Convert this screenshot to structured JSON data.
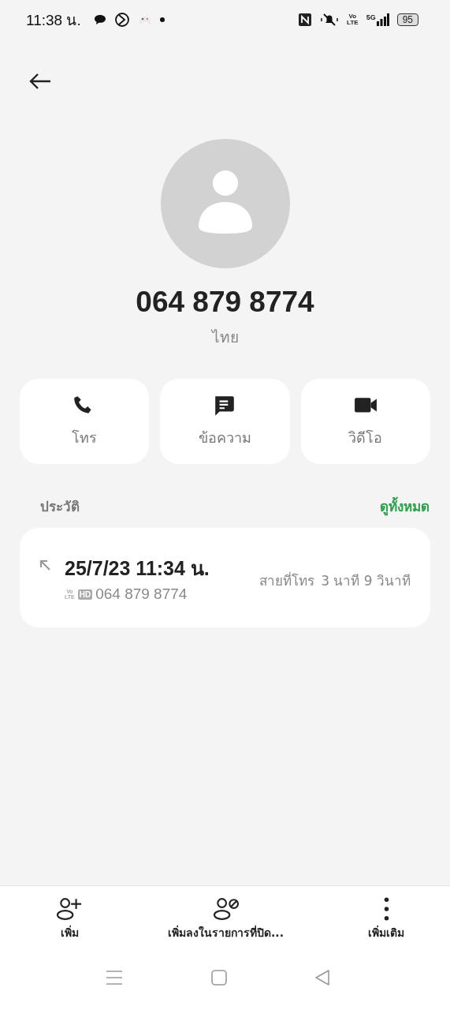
{
  "status_bar": {
    "time": "11:38 น.",
    "volte": [
      "Vo",
      "LTE"
    ],
    "network": "5G",
    "battery": "95"
  },
  "contact": {
    "number": "064 879 8774",
    "region": "ไทย"
  },
  "actions": [
    {
      "kind": "call",
      "label": "โทร"
    },
    {
      "kind": "message",
      "label": "ข้อความ"
    },
    {
      "kind": "video",
      "label": "วิดีโอ"
    }
  ],
  "history": {
    "title": "ประวัติ",
    "view_all": "ดูทั้งหมด",
    "entries": [
      {
        "kind": "outgoing",
        "datetime": "25/7/23 11:34 น.",
        "volte": [
          "Vo",
          "LTE"
        ],
        "hd": "HD",
        "number": "064 879 8774",
        "type": "สายที่โทร",
        "duration": "3 นาที 9 วินาที"
      }
    ]
  },
  "bottom_actions": [
    {
      "kind": "add",
      "label": "เพิ่ม"
    },
    {
      "kind": "block",
      "label": "เพิ่มลงในรายการที่ปิด..."
    },
    {
      "kind": "more",
      "label": "เพิ่มเติม"
    }
  ]
}
